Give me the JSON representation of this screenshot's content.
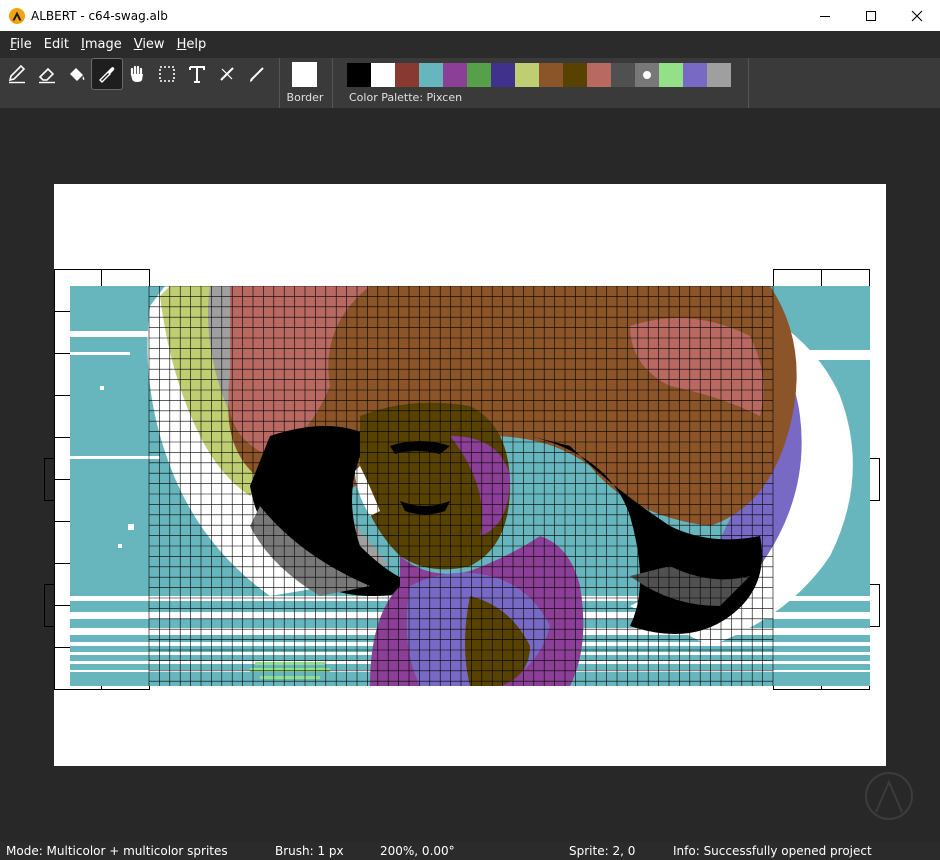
{
  "window": {
    "title": "ALBERT - c64-swag.alb",
    "logo_color": "#f2a30f"
  },
  "menu": [
    {
      "accel": "F",
      "rest": "ile"
    },
    {
      "accel": "",
      "rest": "Edit"
    },
    {
      "accel": "I",
      "rest": "mage"
    },
    {
      "accel": "V",
      "rest": "iew"
    },
    {
      "accel": "H",
      "rest": "elp"
    }
  ],
  "tools": [
    {
      "name": "pencil-icon",
      "active": false
    },
    {
      "name": "eraser-icon",
      "active": false
    },
    {
      "name": "fill-bucket-icon",
      "active": false
    },
    {
      "name": "eyedropper-icon",
      "active": true
    },
    {
      "name": "hand-icon",
      "active": false
    },
    {
      "name": "selection-icon",
      "active": false
    },
    {
      "name": "text-icon",
      "active": false
    },
    {
      "name": "line-icon",
      "active": false
    },
    {
      "name": "brush-icon",
      "active": false
    }
  ],
  "border": {
    "label": "Border",
    "color": "#ffffff"
  },
  "palette": {
    "label": "Color Palette: Pixcen",
    "colors": [
      "#000000",
      "#ffffff",
      "#883932",
      "#67b6bd",
      "#8b3f96",
      "#55a049",
      "#40318d",
      "#bfce72",
      "#8b5429",
      "#574200",
      "#b86962",
      "#505050",
      "#787878",
      "#94e089",
      "#7869c4",
      "#9f9f9f"
    ],
    "selected_index": 12
  },
  "canvas": {
    "background_color": "#67b6bd",
    "grid_color": "#000000"
  },
  "status": {
    "mode": "Mode: Multicolor + multicolor sprites",
    "brush": "Brush: 1 px",
    "zoom": "200%, 0.00°",
    "sprite": "Sprite: 2, 0",
    "info": "Info: Successfully opened project"
  }
}
